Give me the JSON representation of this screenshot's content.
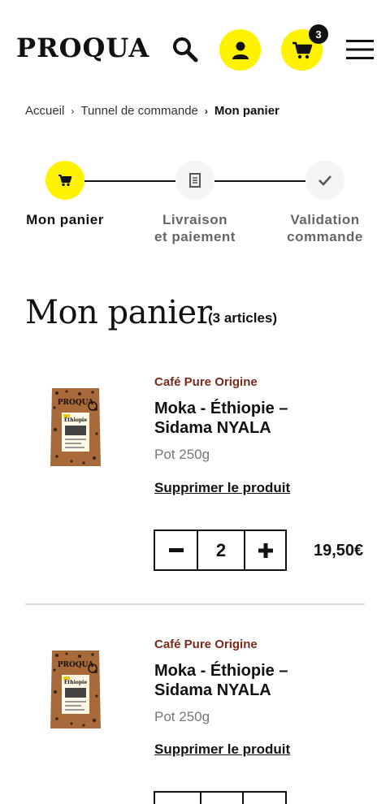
{
  "header": {
    "logo": "PROQUA",
    "cart_count": "3"
  },
  "breadcrumb": {
    "items": [
      "Accueil",
      "Tunnel de commande"
    ],
    "current": "Mon panier"
  },
  "stepper": {
    "steps": [
      {
        "label": "Mon panier",
        "active": true
      },
      {
        "label": "Livraison et paiement",
        "active": false
      },
      {
        "label": "Validation commande",
        "active": false
      }
    ]
  },
  "cart": {
    "title": "Mon panier",
    "count_label": "(3 articles)",
    "products": [
      {
        "category": "Café Pure Origine",
        "name": "Moka - Éthiopie – Sidama NYALA",
        "variant": "Pot 250g",
        "delete_label": "Supprimer le produit",
        "quantity": "2",
        "price": "19,50€"
      },
      {
        "category": "Café Pure Origine",
        "name": "Moka - Éthiopie – Sidama NYALA",
        "variant": "Pot 250g",
        "delete_label": "Supprimer le produit",
        "quantity": "",
        "price": ""
      }
    ]
  },
  "colors": {
    "accent": "#fff200",
    "category": "#7a2a1a"
  }
}
